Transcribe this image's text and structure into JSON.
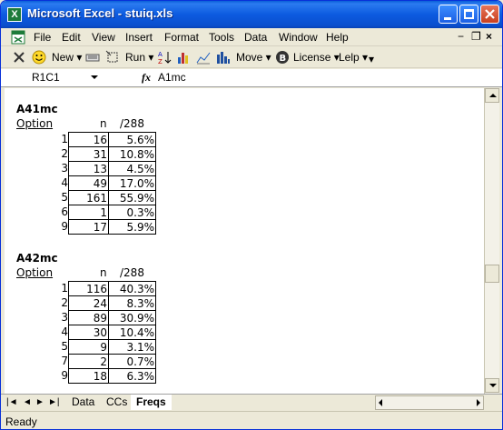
{
  "window": {
    "title": "Microsoft Excel - stuiq.xls",
    "app_icon": "excel-icon"
  },
  "menu": {
    "items": [
      "File",
      "Edit",
      "View",
      "Insert",
      "Format",
      "Tools",
      "Data",
      "Window",
      "Help"
    ],
    "mdi_minimize": "−",
    "mdi_restore": "❐",
    "mdi_close": "×"
  },
  "toolbar": {
    "new_label": "New",
    "run_label": "Run",
    "move_label": "Move",
    "license_label": "License",
    "lelp_label": "Lelp"
  },
  "formula_bar": {
    "name_box": "R1C1",
    "fx_label": "fx",
    "formula": "A1mc"
  },
  "tables": [
    {
      "title": "A41mc",
      "col_option": "Option",
      "col_n": "n",
      "col_pct": "/288",
      "rows": [
        {
          "option": "1",
          "n": "16",
          "pct": "5.6%"
        },
        {
          "option": "2",
          "n": "31",
          "pct": "10.8%"
        },
        {
          "option": "3",
          "n": "13",
          "pct": "4.5%"
        },
        {
          "option": "4",
          "n": "49",
          "pct": "17.0%"
        },
        {
          "option": "5",
          "n": "161",
          "pct": "55.9%"
        },
        {
          "option": "6",
          "n": "1",
          "pct": "0.3%"
        },
        {
          "option": "9",
          "n": "17",
          "pct": "5.9%"
        }
      ]
    },
    {
      "title": "A42mc",
      "col_option": "Option",
      "col_n": "n",
      "col_pct": "/288",
      "rows": [
        {
          "option": "1",
          "n": "116",
          "pct": "40.3%"
        },
        {
          "option": "2",
          "n": "24",
          "pct": "8.3%"
        },
        {
          "option": "3",
          "n": "89",
          "pct": "30.9%"
        },
        {
          "option": "4",
          "n": "30",
          "pct": "10.4%"
        },
        {
          "option": "5",
          "n": "9",
          "pct": "3.1%"
        },
        {
          "option": "7",
          "n": "2",
          "pct": "0.7%"
        },
        {
          "option": "9",
          "n": "18",
          "pct": "6.3%"
        }
      ]
    }
  ],
  "sheet_tabs": {
    "tab1": "Data",
    "tab2": "CCs",
    "tab3": "Freqs",
    "active": "Freqs"
  },
  "tab_nav": {
    "first": "|◄",
    "prev": "◄",
    "next": "►",
    "last": "►|"
  },
  "status": {
    "text": "Ready"
  }
}
